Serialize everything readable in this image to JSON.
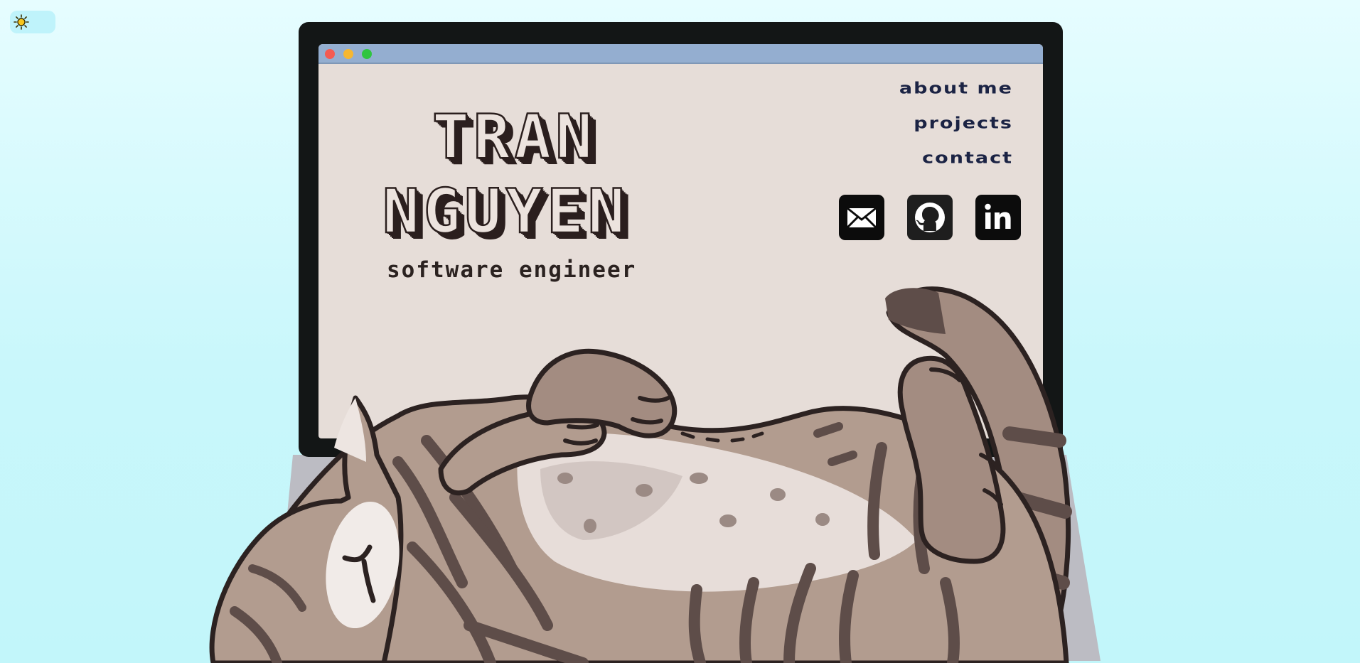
{
  "theme_toggle": {
    "icon": "sun-icon",
    "label": "☀"
  },
  "window": {
    "buttons": [
      "close",
      "minimize",
      "maximize"
    ],
    "colors": {
      "close": "#f45b52",
      "minimize": "#f6b731",
      "maximize": "#2fc540",
      "titlebar": "#94aed0"
    }
  },
  "hero": {
    "first_name": "TRAN",
    "last_name": "NGUYEN",
    "subtitle": "software engineer"
  },
  "nav": {
    "about": "about me",
    "projects": "projects",
    "contact": "contact"
  },
  "social": [
    {
      "name": "email",
      "icon": "mail-icon"
    },
    {
      "name": "github",
      "icon": "github-icon"
    },
    {
      "name": "linkedin",
      "icon": "linkedin-icon"
    }
  ],
  "colors": {
    "background": "#c9f7fb",
    "screen": "#e6ddd8",
    "bezel": "#131616",
    "cat_fur": "#b29c8f",
    "cat_stripes": "#6a5853"
  }
}
